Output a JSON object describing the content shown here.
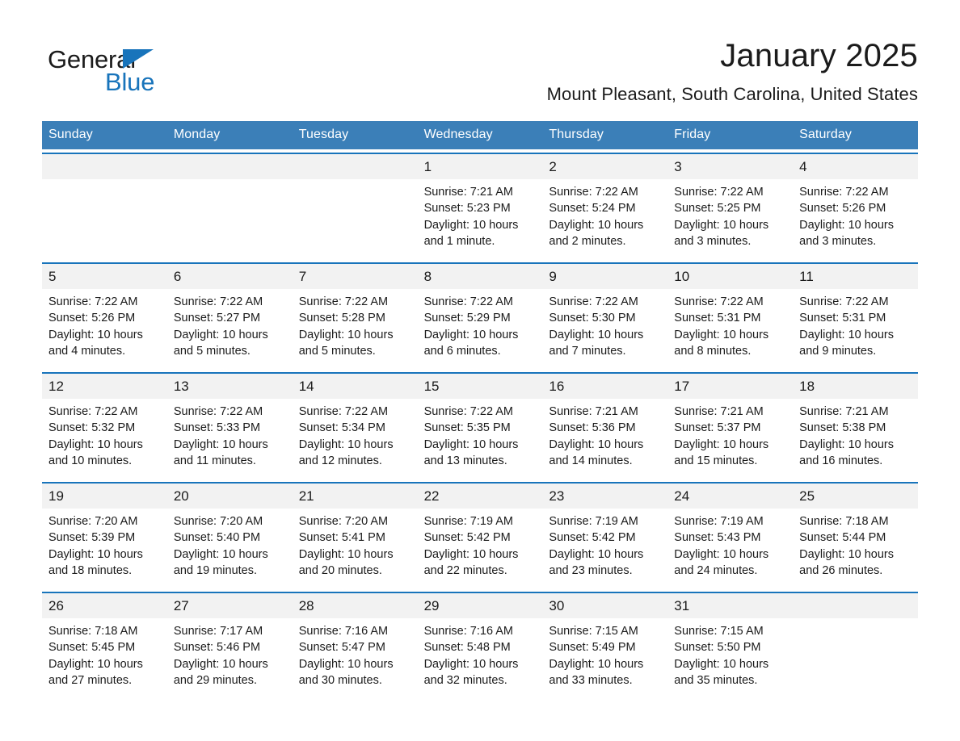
{
  "brand": {
    "name_part1": "General",
    "name_part2": "Blue",
    "triangle_color": "#1874bb"
  },
  "header": {
    "title": "January 2025",
    "location": "Mount Pleasant, South Carolina, United States",
    "header_bg": "#3b7fb8",
    "row_rule_color": "#1874bb",
    "daynum_bg": "#f2f2f2"
  },
  "weekdays": [
    "Sunday",
    "Monday",
    "Tuesday",
    "Wednesday",
    "Thursday",
    "Friday",
    "Saturday"
  ],
  "weeks": [
    [
      {
        "day": "",
        "info": ""
      },
      {
        "day": "",
        "info": ""
      },
      {
        "day": "",
        "info": ""
      },
      {
        "day": "1",
        "info": "Sunrise: 7:21 AM\nSunset: 5:23 PM\nDaylight: 10 hours and 1 minute."
      },
      {
        "day": "2",
        "info": "Sunrise: 7:22 AM\nSunset: 5:24 PM\nDaylight: 10 hours and 2 minutes."
      },
      {
        "day": "3",
        "info": "Sunrise: 7:22 AM\nSunset: 5:25 PM\nDaylight: 10 hours and 3 minutes."
      },
      {
        "day": "4",
        "info": "Sunrise: 7:22 AM\nSunset: 5:26 PM\nDaylight: 10 hours and 3 minutes."
      }
    ],
    [
      {
        "day": "5",
        "info": "Sunrise: 7:22 AM\nSunset: 5:26 PM\nDaylight: 10 hours and 4 minutes."
      },
      {
        "day": "6",
        "info": "Sunrise: 7:22 AM\nSunset: 5:27 PM\nDaylight: 10 hours and 5 minutes."
      },
      {
        "day": "7",
        "info": "Sunrise: 7:22 AM\nSunset: 5:28 PM\nDaylight: 10 hours and 5 minutes."
      },
      {
        "day": "8",
        "info": "Sunrise: 7:22 AM\nSunset: 5:29 PM\nDaylight: 10 hours and 6 minutes."
      },
      {
        "day": "9",
        "info": "Sunrise: 7:22 AM\nSunset: 5:30 PM\nDaylight: 10 hours and 7 minutes."
      },
      {
        "day": "10",
        "info": "Sunrise: 7:22 AM\nSunset: 5:31 PM\nDaylight: 10 hours and 8 minutes."
      },
      {
        "day": "11",
        "info": "Sunrise: 7:22 AM\nSunset: 5:31 PM\nDaylight: 10 hours and 9 minutes."
      }
    ],
    [
      {
        "day": "12",
        "info": "Sunrise: 7:22 AM\nSunset: 5:32 PM\nDaylight: 10 hours and 10 minutes."
      },
      {
        "day": "13",
        "info": "Sunrise: 7:22 AM\nSunset: 5:33 PM\nDaylight: 10 hours and 11 minutes."
      },
      {
        "day": "14",
        "info": "Sunrise: 7:22 AM\nSunset: 5:34 PM\nDaylight: 10 hours and 12 minutes."
      },
      {
        "day": "15",
        "info": "Sunrise: 7:22 AM\nSunset: 5:35 PM\nDaylight: 10 hours and 13 minutes."
      },
      {
        "day": "16",
        "info": "Sunrise: 7:21 AM\nSunset: 5:36 PM\nDaylight: 10 hours and 14 minutes."
      },
      {
        "day": "17",
        "info": "Sunrise: 7:21 AM\nSunset: 5:37 PM\nDaylight: 10 hours and 15 minutes."
      },
      {
        "day": "18",
        "info": "Sunrise: 7:21 AM\nSunset: 5:38 PM\nDaylight: 10 hours and 16 minutes."
      }
    ],
    [
      {
        "day": "19",
        "info": "Sunrise: 7:20 AM\nSunset: 5:39 PM\nDaylight: 10 hours and 18 minutes."
      },
      {
        "day": "20",
        "info": "Sunrise: 7:20 AM\nSunset: 5:40 PM\nDaylight: 10 hours and 19 minutes."
      },
      {
        "day": "21",
        "info": "Sunrise: 7:20 AM\nSunset: 5:41 PM\nDaylight: 10 hours and 20 minutes."
      },
      {
        "day": "22",
        "info": "Sunrise: 7:19 AM\nSunset: 5:42 PM\nDaylight: 10 hours and 22 minutes."
      },
      {
        "day": "23",
        "info": "Sunrise: 7:19 AM\nSunset: 5:42 PM\nDaylight: 10 hours and 23 minutes."
      },
      {
        "day": "24",
        "info": "Sunrise: 7:19 AM\nSunset: 5:43 PM\nDaylight: 10 hours and 24 minutes."
      },
      {
        "day": "25",
        "info": "Sunrise: 7:18 AM\nSunset: 5:44 PM\nDaylight: 10 hours and 26 minutes."
      }
    ],
    [
      {
        "day": "26",
        "info": "Sunrise: 7:18 AM\nSunset: 5:45 PM\nDaylight: 10 hours and 27 minutes."
      },
      {
        "day": "27",
        "info": "Sunrise: 7:17 AM\nSunset: 5:46 PM\nDaylight: 10 hours and 29 minutes."
      },
      {
        "day": "28",
        "info": "Sunrise: 7:16 AM\nSunset: 5:47 PM\nDaylight: 10 hours and 30 minutes."
      },
      {
        "day": "29",
        "info": "Sunrise: 7:16 AM\nSunset: 5:48 PM\nDaylight: 10 hours and 32 minutes."
      },
      {
        "day": "30",
        "info": "Sunrise: 7:15 AM\nSunset: 5:49 PM\nDaylight: 10 hours and 33 minutes."
      },
      {
        "day": "31",
        "info": "Sunrise: 7:15 AM\nSunset: 5:50 PM\nDaylight: 10 hours and 35 minutes."
      },
      {
        "day": "",
        "info": ""
      }
    ]
  ]
}
